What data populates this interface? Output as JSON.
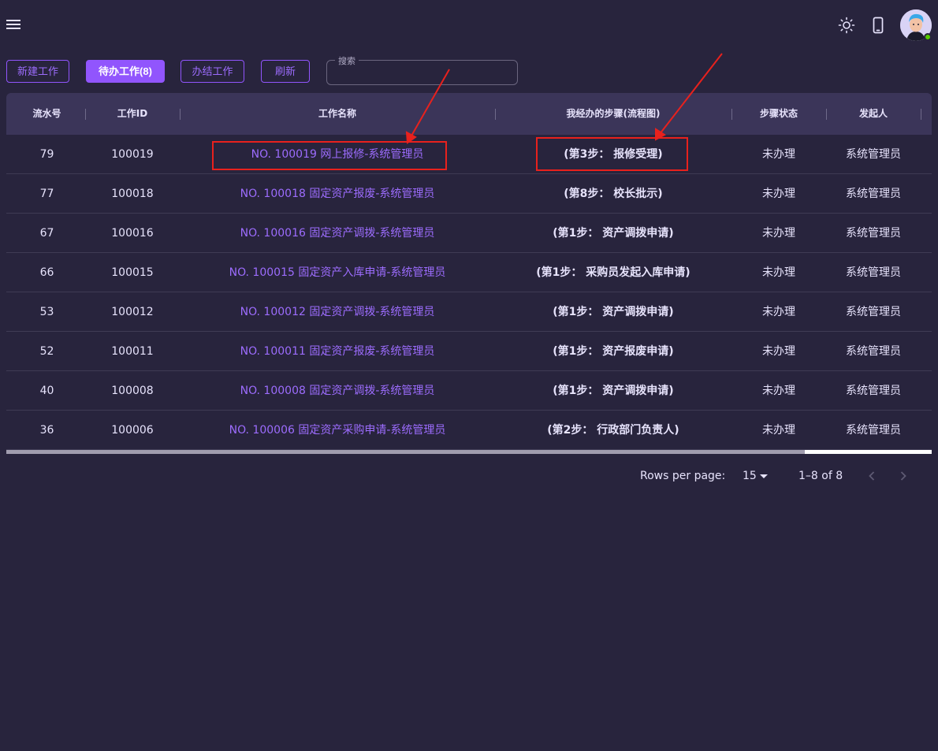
{
  "header": {
    "menu_icon": "hamburger-icon",
    "theme_icon": "sun-icon",
    "device_icon": "phone-icon",
    "avatar_icon": "avatar",
    "online_color": "#56ca00"
  },
  "toolbar": {
    "new_label": "新建工作",
    "pending_label": "待办工作(8)",
    "done_label": "办结工作",
    "refresh_label": "刷新",
    "search_label": "搜索",
    "search_value": ""
  },
  "table": {
    "columns": [
      "流水号",
      "工作ID",
      "工作名称",
      "我经办的步骤(流程图)",
      "步骤状态",
      "发起人"
    ],
    "rows": [
      {
        "serial": "79",
        "work_id": "100019",
        "name": "NO. 100019 网上报修-系统管理员",
        "step": "(第3步：  报修受理)",
        "status": "未办理",
        "initiator": "系统管理员"
      },
      {
        "serial": "77",
        "work_id": "100018",
        "name": "NO. 100018 固定资产报废-系统管理员",
        "step": "(第8步：  校长批示)",
        "status": "未办理",
        "initiator": "系统管理员"
      },
      {
        "serial": "67",
        "work_id": "100016",
        "name": "NO. 100016 固定资产调拨-系统管理员",
        "step": "(第1步：  资产调拨申请)",
        "status": "未办理",
        "initiator": "系统管理员"
      },
      {
        "serial": "66",
        "work_id": "100015",
        "name": "NO. 100015 固定资产入库申请-系统管理员",
        "step": "(第1步：  采购员发起入库申请)",
        "status": "未办理",
        "initiator": "系统管理员"
      },
      {
        "serial": "53",
        "work_id": "100012",
        "name": "NO. 100012 固定资产调拨-系统管理员",
        "step": "(第1步：  资产调拨申请)",
        "status": "未办理",
        "initiator": "系统管理员"
      },
      {
        "serial": "52",
        "work_id": "100011",
        "name": "NO. 100011 固定资产报废-系统管理员",
        "step": "(第1步：  资产报废申请)",
        "status": "未办理",
        "initiator": "系统管理员"
      },
      {
        "serial": "40",
        "work_id": "100008",
        "name": "NO. 100008 固定资产调拨-系统管理员",
        "step": "(第1步：  资产调拨申请)",
        "status": "未办理",
        "initiator": "系统管理员"
      },
      {
        "serial": "36",
        "work_id": "100006",
        "name": "NO. 100006 固定资产采购申请-系统管理员",
        "step": "(第2步：  行政部门负责人)",
        "status": "未办理",
        "initiator": "系统管理员"
      }
    ]
  },
  "pagination": {
    "rows_per_page_label": "Rows per page:",
    "rows_per_page_value": "15",
    "range_text": "1–8 of 8",
    "prev_icon": "chevron-left-icon",
    "next_icon": "chevron-right-icon"
  },
  "colors": {
    "background": "#28243d",
    "accent": "#9155fd",
    "annotation": "#e8211d"
  }
}
